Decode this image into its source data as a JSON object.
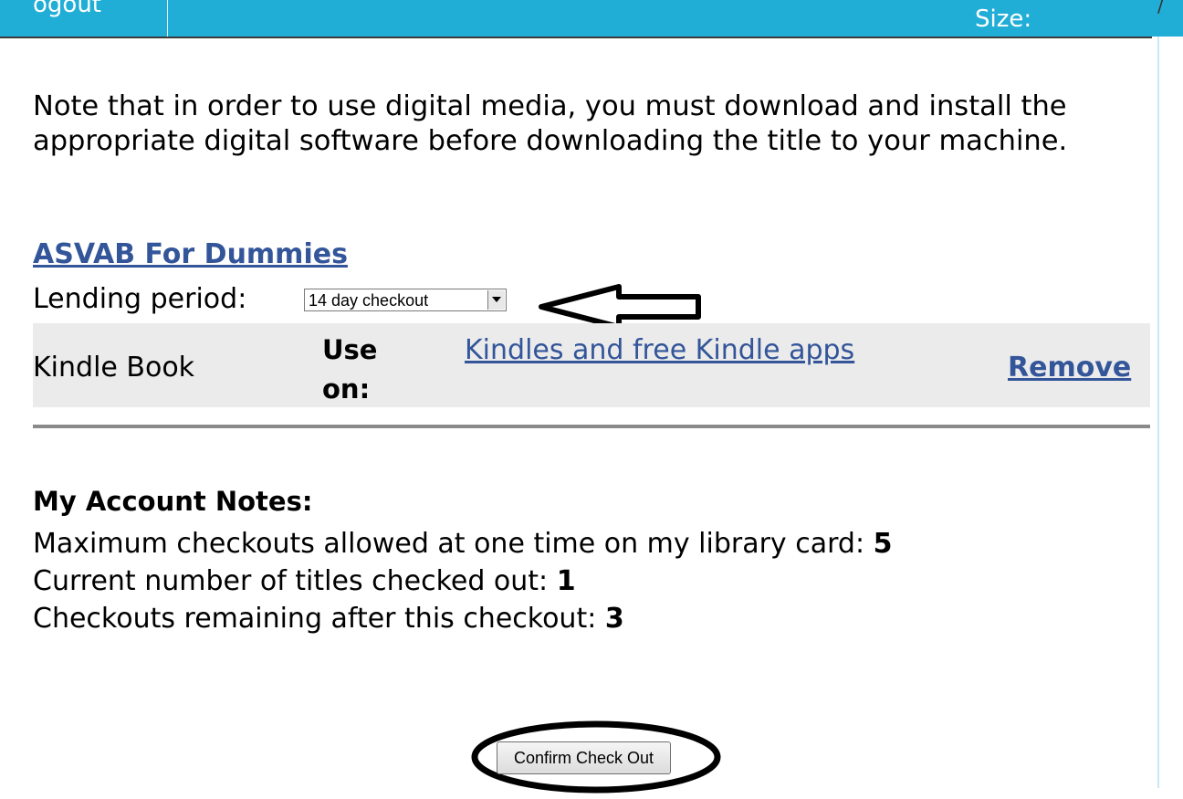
{
  "header": {
    "logout_label": "ogout",
    "size_label": "Size:",
    "corner_mark": "/",
    "bar_color": "#21aed6"
  },
  "note": "Note that in order to use digital media, you must download and install the appropriate digital software before downloading the title to your machine.",
  "title": {
    "name": "ASVAB For Dummies"
  },
  "lending": {
    "label": "Lending period:",
    "selected": "14 day checkout"
  },
  "format_row": {
    "type": "Kindle Book",
    "use_on_label_1": "Use",
    "use_on_label_2": "on:",
    "apps_link": "Kindles and free Kindle apps",
    "remove_label": "Remove"
  },
  "account_notes": {
    "heading": "My Account Notes:",
    "max_label": "Maximum checkouts allowed at one time on my library card:",
    "max_value": "5",
    "current_label": "Current number of titles checked out:",
    "current_value": "1",
    "remaining_label": "Checkouts remaining after this checkout:",
    "remaining_value": "3"
  },
  "actions": {
    "confirm_label": "Confirm Check Out"
  },
  "annotations": {
    "arrow": "left-arrow-icon",
    "circle": "ellipse-highlight"
  },
  "colors": {
    "link": "#335599",
    "row_bg": "#ebebeb"
  }
}
